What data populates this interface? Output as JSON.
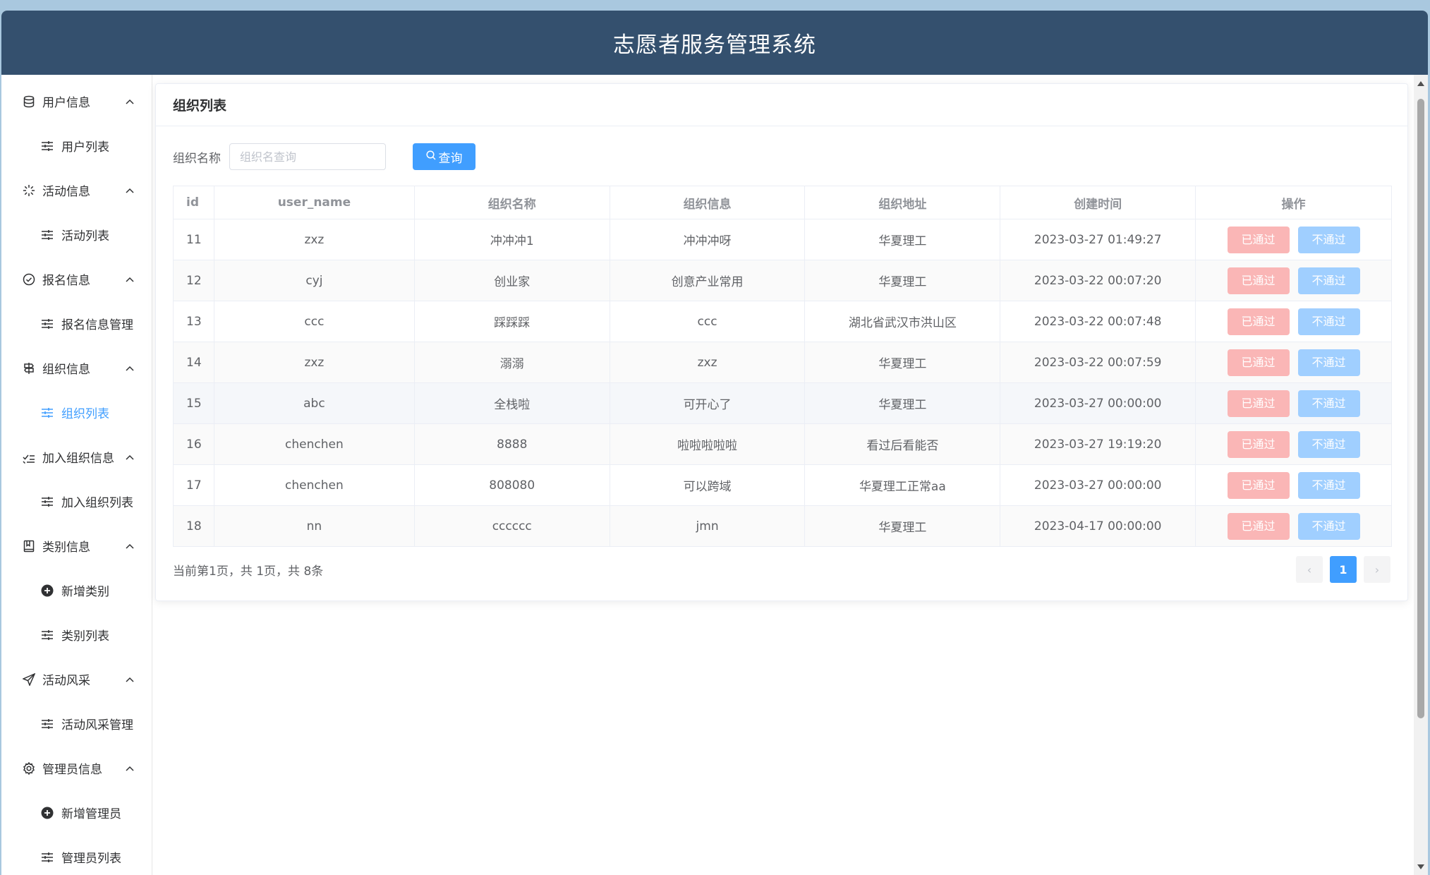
{
  "app": {
    "title": "志愿者服务管理系统"
  },
  "sidebar": {
    "groups": [
      {
        "label": "用户信息",
        "icon": "database-icon",
        "items": [
          {
            "label": "用户列表",
            "icon": "sliders-icon"
          }
        ]
      },
      {
        "label": "活动信息",
        "icon": "sparkle-icon",
        "items": [
          {
            "label": "活动列表",
            "icon": "sliders-icon"
          }
        ]
      },
      {
        "label": "报名信息",
        "icon": "check-circle-icon",
        "items": [
          {
            "label": "报名信息管理",
            "icon": "sliders-icon"
          }
        ]
      },
      {
        "label": "组织信息",
        "icon": "signpost-icon",
        "items": [
          {
            "label": "组织列表",
            "icon": "sliders-icon",
            "active": true
          }
        ]
      },
      {
        "label": "加入组织信息",
        "icon": "checklist-icon",
        "items": [
          {
            "label": "加入组织列表",
            "icon": "sliders-icon"
          }
        ]
      },
      {
        "label": "类别信息",
        "icon": "notebook-icon",
        "items": [
          {
            "label": "新增类别",
            "icon": "plus-circle-icon"
          },
          {
            "label": "类别列表",
            "icon": "sliders-icon"
          }
        ]
      },
      {
        "label": "活动风采",
        "icon": "send-icon",
        "items": [
          {
            "label": "活动风采管理",
            "icon": "sliders-icon"
          }
        ]
      },
      {
        "label": "管理员信息",
        "icon": "gear-icon",
        "items": [
          {
            "label": "新增管理员",
            "icon": "plus-circle-icon"
          },
          {
            "label": "管理员列表",
            "icon": "sliders-icon"
          }
        ]
      }
    ]
  },
  "main": {
    "card_title": "组织列表",
    "search": {
      "label": "组织名称",
      "placeholder": "组织名查询",
      "value": "",
      "button": "查询"
    },
    "table": {
      "headers": [
        "id",
        "user_name",
        "组织名称",
        "组织信息",
        "组织地址",
        "创建时间",
        "操作"
      ],
      "rows": [
        {
          "id": "11",
          "user_name": "zxz",
          "org_name": "冲冲冲1",
          "org_info": "冲冲冲呀",
          "org_addr": "华夏理工",
          "created": "2023-03-27 01:49:27"
        },
        {
          "id": "12",
          "user_name": "cyj",
          "org_name": "创业家",
          "org_info": "创意产业常用",
          "org_addr": "华夏理工",
          "created": "2023-03-22 00:07:20"
        },
        {
          "id": "13",
          "user_name": "ccc",
          "org_name": "踩踩踩",
          "org_info": "ccc",
          "org_addr": "湖北省武汉市洪山区",
          "created": "2023-03-22 00:07:48"
        },
        {
          "id": "14",
          "user_name": "zxz",
          "org_name": "溺溺",
          "org_info": "zxz",
          "org_addr": "华夏理工",
          "created": "2023-03-22 00:07:59"
        },
        {
          "id": "15",
          "user_name": "abc",
          "org_name": "全栈啦",
          "org_info": "可开心了",
          "org_addr": "华夏理工",
          "created": "2023-03-27 00:00:00"
        },
        {
          "id": "16",
          "user_name": "chenchen",
          "org_name": "8888",
          "org_info": "啦啦啦啦啦",
          "org_addr": "看过后看能否",
          "created": "2023-03-27 19:19:20"
        },
        {
          "id": "17",
          "user_name": "chenchen",
          "org_name": "808080",
          "org_info": "可以跨域",
          "org_addr": "华夏理工正常aa",
          "created": "2023-03-27 00:00:00"
        },
        {
          "id": "18",
          "user_name": "nn",
          "org_name": "cccccc",
          "org_info": "jmn",
          "org_addr": "华夏理工",
          "created": "2023-04-17 00:00:00"
        }
      ],
      "actions": {
        "pass": "已通过",
        "fail": "不通过"
      }
    },
    "pagination": {
      "summary": "当前第1页，共 1页，共 8条",
      "current": "1",
      "prev": "‹",
      "next": "›"
    }
  },
  "colors": {
    "header_bg": "#34506e",
    "primary": "#409eff",
    "pass_btn": "#fab6b6",
    "fail_btn": "#a0cfff"
  }
}
